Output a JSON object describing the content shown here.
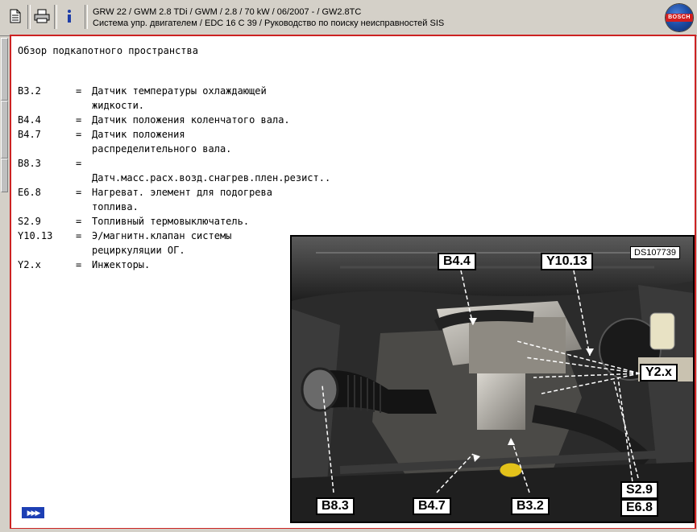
{
  "toolbar": {
    "header_line1": "GRW 22 / GWM 2.8 TDi / GWM / 2.8 / 70 kW / 06/2007 -  / GW2.8TC",
    "header_line2": "Система упр. двигателем / EDC 16 C 39 / Руководство по поиску неисправностей SIS",
    "logo_text": "BOSCH"
  },
  "content": {
    "title": "Обзор подкапотного пространства",
    "rows": [
      {
        "code": "B3.2",
        "eq": "=",
        "desc": "Датчик температуры охлаждающей"
      },
      {
        "code": "",
        "eq": "",
        "desc": "жидкости."
      },
      {
        "code": "B4.4",
        "eq": "=",
        "desc": "Датчик положения коленчатого вала."
      },
      {
        "code": "B4.7",
        "eq": "=",
        "desc": "Датчик положения"
      },
      {
        "code": "",
        "eq": "",
        "desc": "распределительного вала."
      },
      {
        "code": "B8.3",
        "eq": "=",
        "desc": ""
      },
      {
        "code": "",
        "eq": "",
        "desc": "Датч.масс.расх.возд.снагрев.плен.резист.."
      },
      {
        "code": "E6.8",
        "eq": "=",
        "desc": "Нагреват. элемент для подогрева"
      },
      {
        "code": "",
        "eq": "",
        "desc": "топлива."
      },
      {
        "code": "S2.9",
        "eq": "=",
        "desc": "Топливный термовыключатель."
      },
      {
        "code": "Y10.13",
        "eq": "=",
        "desc": "Э/магнитн.клапан системы"
      },
      {
        "code": "",
        "eq": "",
        "desc": "рециркуляции ОГ."
      },
      {
        "code": "Y2.x",
        "eq": "=",
        "desc": "Инжекторы."
      }
    ]
  },
  "photo": {
    "id_label": "DS107739",
    "labels": {
      "b44": "B4.4",
      "y1013": "Y10.13",
      "y2x": "Y2.x",
      "b83": "B8.3",
      "b47": "B4.7",
      "b32": "B3.2",
      "s29": "S2.9",
      "e68": "E6.8"
    }
  },
  "colors": {
    "frame_border": "#cc2222",
    "nav_arrow_bg": "#1d3fb4"
  },
  "icons": {
    "doc": "document-icon",
    "print": "printer-icon",
    "info": "info-icon",
    "next": "next-page-icon"
  }
}
